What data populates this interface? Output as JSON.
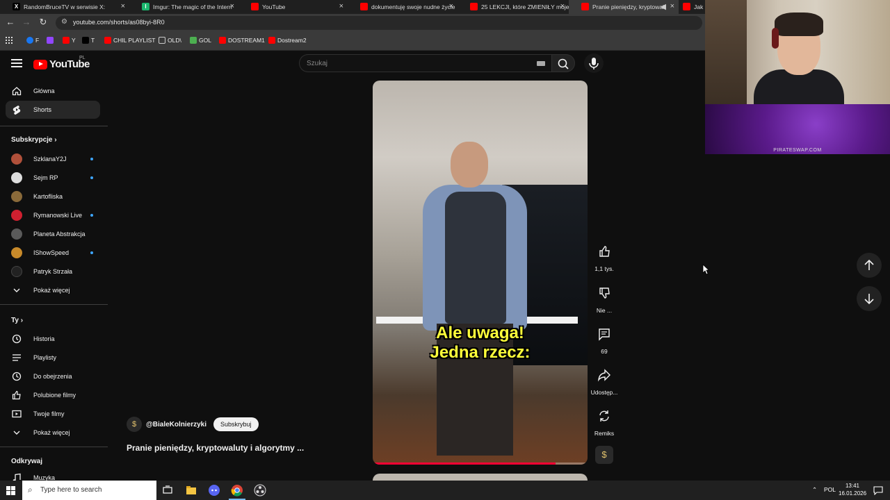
{
  "browser": {
    "tabs": [
      {
        "title": "RandomBruceTV w serwisie X:",
        "fav": "X",
        "color": "#000000"
      },
      {
        "title": "Imgur: The magic of the Intern",
        "fav": "I",
        "color": "#1bb76e"
      },
      {
        "title": "YouTube",
        "fav": "",
        "color": "#ff0000"
      },
      {
        "title": "dokumentuję swoje nudne życie",
        "fav": "",
        "color": "#ff0000"
      },
      {
        "title": "25 LEKCJI, które ZMIENIŁY moje",
        "fav": "",
        "color": "#ff0000"
      },
      {
        "title": "Pranie pieniędzy, kryptowal",
        "fav": "",
        "color": "#ff0000"
      },
      {
        "title": "Jak",
        "fav": "",
        "color": "#ff0000"
      }
    ],
    "url": "youtube.com/shorts/as08byi-8R0",
    "bookmarks": [
      {
        "label": "F",
        "color": "#1877f2"
      },
      {
        "label": "",
        "color": "#9146ff"
      },
      {
        "label": "Y",
        "color": "#ff0000"
      },
      {
        "label": "T",
        "color": "#000000"
      },
      {
        "label": "CHIL PLAYLIST",
        "color": "#ff0000"
      },
      {
        "label": "OLD\\",
        "color": "#aaaaaa"
      },
      {
        "label": "GOL",
        "color": "#4caf50"
      },
      {
        "label": "DOSTREAM1",
        "color": "#ff0000"
      },
      {
        "label": "Dostream2",
        "color": "#ff0000"
      }
    ]
  },
  "youtube": {
    "logo_text": "YouTube",
    "country_code": "PL",
    "search_placeholder": "Szukaj"
  },
  "sidebar": {
    "main": [
      {
        "label": "Główna",
        "icon": "home-icon"
      },
      {
        "label": "Shorts",
        "icon": "shorts-icon"
      }
    ],
    "subscriptions_header": "Subskrypcje",
    "subscriptions": [
      {
        "label": "SzklanaY2J",
        "color": "#b0503a",
        "new": true
      },
      {
        "label": "Sejm RP",
        "color": "#dddddd",
        "new": true
      },
      {
        "label": "Kartofliska",
        "color": "#8a6a3a",
        "new": false
      },
      {
        "label": "Rymanowski Live",
        "color": "#d02030",
        "new": true
      },
      {
        "label": "Planeta Abstrakcja",
        "color": "#5a5a5a",
        "new": false
      },
      {
        "label": "IShowSpeed",
        "color": "#c88a2a",
        "new": true
      },
      {
        "label": "Patryk Strzała",
        "color": "#222222",
        "new": false
      }
    ],
    "show_more": "Pokaż więcej",
    "you_header": "Ty",
    "you": [
      {
        "label": "Historia",
        "icon": "history-icon"
      },
      {
        "label": "Playlisty",
        "icon": "playlist-icon"
      },
      {
        "label": "Do obejrzenia",
        "icon": "clock-icon"
      },
      {
        "label": "Polubione filmy",
        "icon": "like-icon"
      },
      {
        "label": "Twoje filmy",
        "icon": "video-icon"
      }
    ],
    "show_more_2": "Pokaż więcej",
    "explore_header": "Odkrywaj",
    "explore": [
      {
        "label": "Muzyka",
        "icon": "music-icon"
      }
    ]
  },
  "short": {
    "caption_line1": "Ale uwaga!",
    "caption_line2": "Jedna rzecz:",
    "progress": 0.85,
    "channel": "@BialeKolnierzyki",
    "subscribe_label": "Subskrybuj",
    "title": "Pranie pieniędzy, kryptowaluty i algorytmy ...",
    "actions": {
      "like": "1,1 tys.",
      "dislike": "Nie ...",
      "comments": "69",
      "share": "Udostęp...",
      "remix": "Remiks"
    }
  },
  "overlay": {
    "banner_text": "PIRATESWAP.COM"
  },
  "taskbar": {
    "search_placeholder": "Type here to search",
    "language": "POL",
    "time": "13:41",
    "date": "16.01.2026"
  }
}
